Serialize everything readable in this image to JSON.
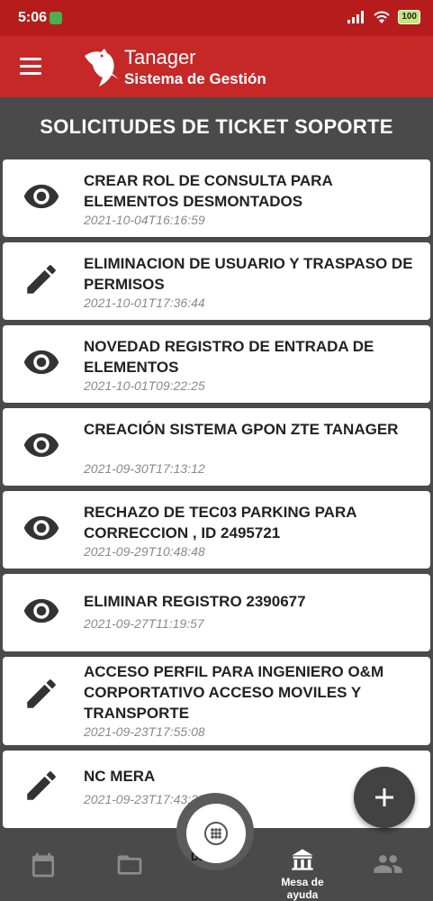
{
  "status_bar": {
    "time": "5:06",
    "battery": "100"
  },
  "app_bar": {
    "brand_name": "Tanager",
    "brand_subtitle": "Sistema de Gestión"
  },
  "page": {
    "title": "SOLICITUDES DE TICKET SOPORTE"
  },
  "tickets": [
    {
      "icon": "eye-icon",
      "title": "CREAR ROL DE CONSULTA PARA ELEMENTOS DESMONTADOS",
      "date": "2021-10-04T16:16:59"
    },
    {
      "icon": "pencil-icon",
      "title": "ELIMINACION DE USUARIO Y TRASPASO DE PERMISOS",
      "date": "2021-10-01T17:36:44"
    },
    {
      "icon": "eye-icon",
      "title": "NOVEDAD REGISTRO DE ENTRADA DE ELEMENTOS",
      "date": "2021-10-01T09:22:25"
    },
    {
      "icon": "eye-icon",
      "title": "CREACIÓN SISTEMA GPON ZTE TANAGER",
      "date": "2021-09-30T17:13:12"
    },
    {
      "icon": "eye-icon",
      "title": "RECHAZO DE TEC03 PARKING PARA CORRECCION , ID 2495721",
      "date": "2021-09-29T10:48:48"
    },
    {
      "icon": "eye-icon",
      "title": "ELIMINAR REGISTRO 2390677",
      "date": "2021-09-27T11:19:57"
    },
    {
      "icon": "pencil-icon",
      "title": "ACCESO PERFIL PARA INGENIERO O&M CORPORTATIVO ACCESO MOVILES Y TRANSPORTE",
      "date": "2021-09-23T17:55:08"
    },
    {
      "icon": "pencil-icon",
      "title": "NC MERA",
      "date": "2021-09-23T17:43:29"
    }
  ],
  "bottom_nav": {
    "items": [
      {
        "icon": "calendar-icon",
        "label": ""
      },
      {
        "icon": "folder-icon",
        "label": ""
      },
      {
        "icon": "building-icon",
        "label": "Mesa de ayuda"
      },
      {
        "icon": "people-icon",
        "label": ""
      }
    ],
    "center_peek_text": "DENUE"
  },
  "colors": {
    "app_bar": "#c62828",
    "status_bar": "#b71c1c",
    "background": "#4a4a4a",
    "card": "#ffffff",
    "fab": "#424242"
  }
}
